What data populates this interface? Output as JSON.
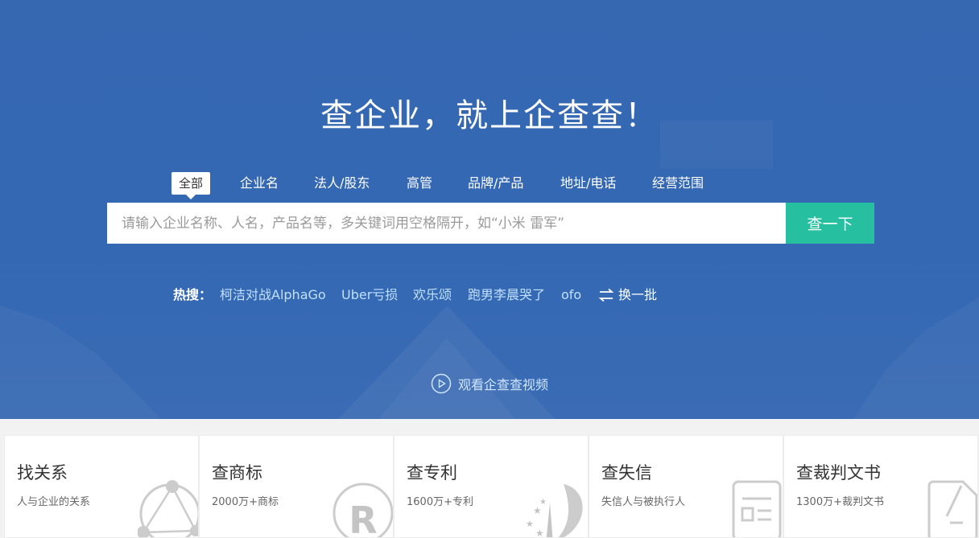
{
  "hero": {
    "slogan": "查企业，就上企查查！",
    "video_label": "观看企查查视频"
  },
  "tabs": [
    "全部",
    "企业名",
    "法人/股东",
    "高管",
    "品牌/产品",
    "地址/电话",
    "经营范围"
  ],
  "active_tab": "全部",
  "search": {
    "value": "",
    "placeholder": "请输入企业名称、人名，产品名等，多关键词用空格隔开，如“小米 雷军”",
    "button_label": "查一下"
  },
  "hot": {
    "label": "热搜：",
    "items": [
      "柯洁对战AlphaGo",
      "Uber亏损",
      "欢乐颂",
      "跑男李晨哭了",
      "ofo"
    ],
    "refresh_label": "换一批"
  },
  "features": [
    {
      "title": "找关系",
      "subtitle": "人与企业的关系",
      "icon": "network-icon"
    },
    {
      "title": "查商标",
      "subtitle": "2000万+商标",
      "icon": "trademark-icon"
    },
    {
      "title": "查专利",
      "subtitle": "1600万+专利",
      "icon": "patent-icon"
    },
    {
      "title": "查失信",
      "subtitle": "失信人与被执行人",
      "icon": "document-icon"
    },
    {
      "title": "查裁判文书",
      "subtitle": "1300万+裁判文书",
      "icon": "judgment-icon"
    }
  ],
  "colors": {
    "hero_blue": "#3468b3",
    "search_button": "#26c0a1",
    "hot_link": "#bfe0ff"
  }
}
